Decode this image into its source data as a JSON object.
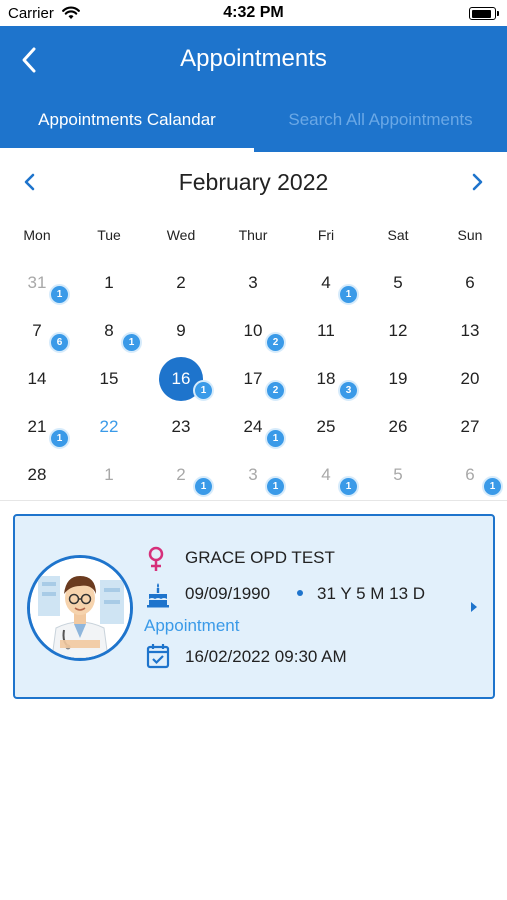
{
  "status_bar": {
    "carrier": "Carrier",
    "time": "4:32 PM",
    "battery_level": 0.95
  },
  "header": {
    "title": "Appointments"
  },
  "tabs": [
    {
      "label": "Appointments Calandar",
      "active": true
    },
    {
      "label": "Search All Appointments",
      "active": false
    }
  ],
  "calendar": {
    "month_label": "February 2022",
    "weekdays": [
      "Mon",
      "Tue",
      "Wed",
      "Thur",
      "Fri",
      "Sat",
      "Sun"
    ],
    "weeks": [
      [
        {
          "day": "31",
          "muted": true,
          "badge": "1"
        },
        {
          "day": "1"
        },
        {
          "day": "2"
        },
        {
          "day": "3"
        },
        {
          "day": "4",
          "badge": "1"
        },
        {
          "day": "5"
        },
        {
          "day": "6"
        }
      ],
      [
        {
          "day": "7",
          "badge": "6"
        },
        {
          "day": "8",
          "badge": "1"
        },
        {
          "day": "9"
        },
        {
          "day": "10",
          "badge": "2"
        },
        {
          "day": "11"
        },
        {
          "day": "12"
        },
        {
          "day": "13"
        }
      ],
      [
        {
          "day": "14"
        },
        {
          "day": "15"
        },
        {
          "day": "16",
          "selected": true,
          "badge": "1"
        },
        {
          "day": "17",
          "badge": "2"
        },
        {
          "day": "18",
          "badge": "3"
        },
        {
          "day": "19"
        },
        {
          "day": "20"
        }
      ],
      [
        {
          "day": "21",
          "badge": "1"
        },
        {
          "day": "22",
          "today": true
        },
        {
          "day": "23"
        },
        {
          "day": "24",
          "badge": "1"
        },
        {
          "day": "25"
        },
        {
          "day": "26"
        },
        {
          "day": "27"
        }
      ],
      [
        {
          "day": "28"
        },
        {
          "day": "1",
          "muted": true
        },
        {
          "day": "2",
          "muted": true,
          "badge": "1"
        },
        {
          "day": "3",
          "muted": true,
          "badge": "1"
        },
        {
          "day": "4",
          "muted": true,
          "badge": "1"
        },
        {
          "day": "5",
          "muted": true
        },
        {
          "day": "6",
          "muted": true,
          "badge": "1"
        }
      ]
    ]
  },
  "appointment_card": {
    "patient_name": "GRACE OPD TEST",
    "dob": "09/09/1990",
    "age": "31 Y 5 M 13 D",
    "section_label": "Appointment",
    "datetime": "16/02/2022 09:30 AM"
  },
  "colors": {
    "primary": "#1e74cc",
    "accent": "#3a9ae8",
    "card_bg": "#e2f0fb",
    "gender_icon": "#d6307a"
  },
  "icons": [
    "back-arrow-icon",
    "chevron-left-icon",
    "chevron-right-icon",
    "female-icon",
    "cake-icon",
    "calendar-check-icon",
    "doctor-avatar",
    "wifi-icon",
    "battery-icon"
  ]
}
